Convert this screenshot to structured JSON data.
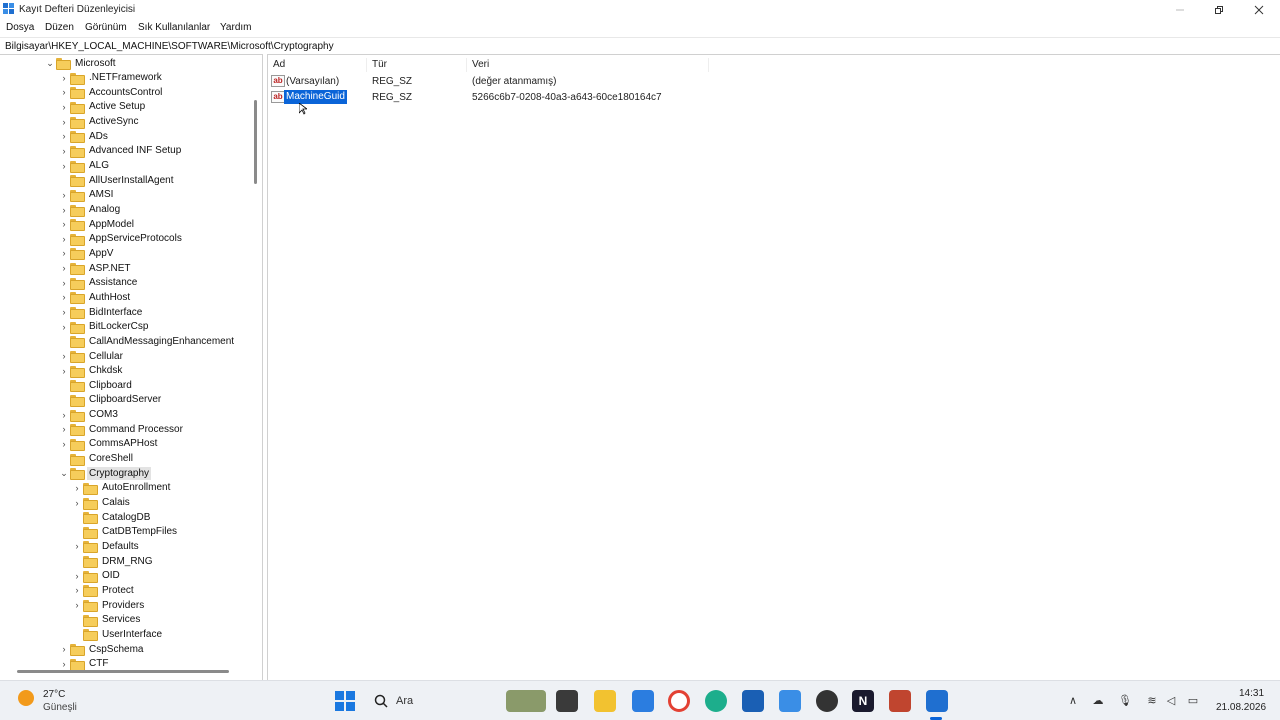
{
  "window": {
    "title": "Kayıt Defteri Düzenleyicisi"
  },
  "menu": [
    "Dosya",
    "Düzen",
    "Görünüm",
    "Sık Kullanılanlar",
    "Yardım"
  ],
  "address": "Bilgisayar\\HKEY_LOCAL_MACHINE\\SOFTWARE\\Microsoft\\Cryptography",
  "tree": [
    {
      "label": "Microsoft",
      "level": 0,
      "state": "expanded"
    },
    {
      "label": ".NETFramework",
      "level": 1,
      "state": "collapsed"
    },
    {
      "label": "AccountsControl",
      "level": 1,
      "state": "collapsed"
    },
    {
      "label": "Active Setup",
      "level": 1,
      "state": "collapsed"
    },
    {
      "label": "ActiveSync",
      "level": 1,
      "state": "collapsed"
    },
    {
      "label": "ADs",
      "level": 1,
      "state": "collapsed"
    },
    {
      "label": "Advanced INF Setup",
      "level": 1,
      "state": "collapsed"
    },
    {
      "label": "ALG",
      "level": 1,
      "state": "collapsed"
    },
    {
      "label": "AllUserInstallAgent",
      "level": 1,
      "state": "leaf"
    },
    {
      "label": "AMSI",
      "level": 1,
      "state": "collapsed"
    },
    {
      "label": "Analog",
      "level": 1,
      "state": "collapsed"
    },
    {
      "label": "AppModel",
      "level": 1,
      "state": "collapsed"
    },
    {
      "label": "AppServiceProtocols",
      "level": 1,
      "state": "collapsed"
    },
    {
      "label": "AppV",
      "level": 1,
      "state": "collapsed"
    },
    {
      "label": "ASP.NET",
      "level": 1,
      "state": "collapsed"
    },
    {
      "label": "Assistance",
      "level": 1,
      "state": "collapsed"
    },
    {
      "label": "AuthHost",
      "level": 1,
      "state": "collapsed"
    },
    {
      "label": "BidInterface",
      "level": 1,
      "state": "collapsed"
    },
    {
      "label": "BitLockerCsp",
      "level": 1,
      "state": "collapsed"
    },
    {
      "label": "CallAndMessagingEnhancement",
      "level": 1,
      "state": "leaf"
    },
    {
      "label": "Cellular",
      "level": 1,
      "state": "collapsed"
    },
    {
      "label": "Chkdsk",
      "level": 1,
      "state": "collapsed"
    },
    {
      "label": "Clipboard",
      "level": 1,
      "state": "leaf"
    },
    {
      "label": "ClipboardServer",
      "level": 1,
      "state": "leaf"
    },
    {
      "label": "COM3",
      "level": 1,
      "state": "collapsed"
    },
    {
      "label": "Command Processor",
      "level": 1,
      "state": "collapsed"
    },
    {
      "label": "CommsAPHost",
      "level": 1,
      "state": "collapsed"
    },
    {
      "label": "CoreShell",
      "level": 1,
      "state": "leaf"
    },
    {
      "label": "Cryptography",
      "level": 1,
      "state": "expanded",
      "selected": true
    },
    {
      "label": "AutoEnrollment",
      "level": 2,
      "state": "collapsed"
    },
    {
      "label": "Calais",
      "level": 2,
      "state": "collapsed"
    },
    {
      "label": "CatalogDB",
      "level": 2,
      "state": "leaf"
    },
    {
      "label": "CatDBTempFiles",
      "level": 2,
      "state": "leaf"
    },
    {
      "label": "Defaults",
      "level": 2,
      "state": "collapsed"
    },
    {
      "label": "DRM_RNG",
      "level": 2,
      "state": "leaf"
    },
    {
      "label": "OID",
      "level": 2,
      "state": "collapsed"
    },
    {
      "label": "Protect",
      "level": 2,
      "state": "collapsed"
    },
    {
      "label": "Providers",
      "level": 2,
      "state": "collapsed"
    },
    {
      "label": "Services",
      "level": 2,
      "state": "leaf"
    },
    {
      "label": "UserInterface",
      "level": 2,
      "state": "leaf"
    },
    {
      "label": "CspSchema",
      "level": 1,
      "state": "collapsed"
    },
    {
      "label": "CTF",
      "level": 1,
      "state": "collapsed"
    }
  ],
  "list": {
    "headers": {
      "name": "Ad",
      "type": "Tür",
      "data": "Veri"
    },
    "rows": [
      {
        "name": "(Varsayılan)",
        "type": "REG_SZ",
        "data": "(değer atanmamış)",
        "selected": false
      },
      {
        "name": "MachineGuid",
        "type": "REG_SZ",
        "data": "5266c6b7-0208-40a3-a643-60ce180164c7",
        "selected": true
      }
    ]
  },
  "taskbar": {
    "weather_temp": "27°C",
    "weather_desc": "Güneşli",
    "search_label": "Ara",
    "time": "14:31",
    "date": "21.08.2026"
  },
  "colors": {
    "selection": "#0a64d8",
    "folder": "#f6cd5b",
    "taskbar_bg": "#eef1f5"
  }
}
